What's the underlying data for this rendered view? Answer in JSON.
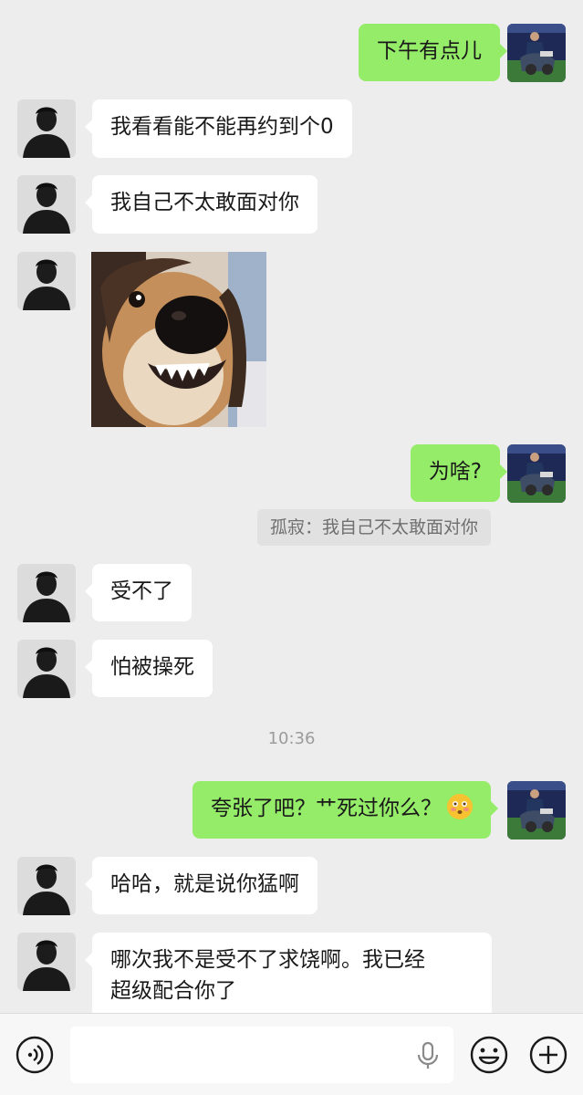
{
  "messages": [
    {
      "side": "out",
      "text": "下午有点儿"
    },
    {
      "side": "in",
      "text": "我看看能不能再约到个0"
    },
    {
      "side": "in",
      "text": "我自己不太敢面对你"
    },
    {
      "side": "in",
      "type": "image",
      "image": "dog-photo"
    },
    {
      "side": "out",
      "text": "为啥?"
    },
    {
      "type": "quote",
      "text": "孤寂：我自己不太敢面对你"
    },
    {
      "side": "in",
      "text": "受不了"
    },
    {
      "side": "in",
      "text": "怕被操死"
    },
    {
      "type": "time",
      "text": "10:36"
    },
    {
      "side": "out",
      "text": "夸张了吧？艹死过你么？",
      "emoji": "flushed-face-emoji"
    },
    {
      "side": "in",
      "text": "哈哈，就是说你猛啊"
    },
    {
      "side": "in",
      "line1": "哪次我不是受不了求饶啊。我已经",
      "line2": "超级配合你了"
    }
  ],
  "input_bar": {
    "voice_icon": "voice-icon",
    "mic_icon": "mic-icon",
    "emoji_icon": "emoji-icon",
    "plus_icon": "plus-icon",
    "value": ""
  },
  "colors": {
    "background": "#ededed",
    "outgoing_bubble": "#95ec69",
    "incoming_bubble": "#ffffff",
    "quote_bg": "#e1e1e1"
  }
}
